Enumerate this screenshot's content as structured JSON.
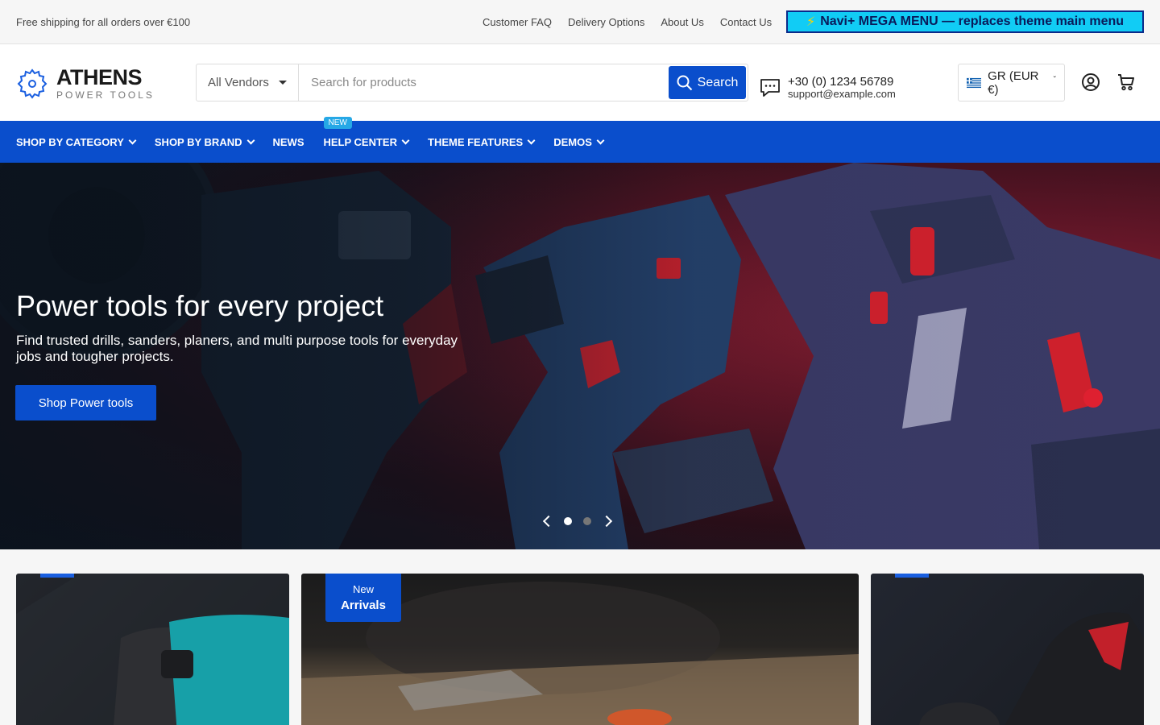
{
  "topbar": {
    "shipping": "Free shipping for all orders over €100",
    "links": [
      "Customer FAQ",
      "Delivery Options",
      "About Us",
      "Contact Us"
    ],
    "mega_menu": "Navi+ MEGA MENU — replaces theme main menu"
  },
  "header": {
    "logo_title": "ATHENS",
    "logo_subtitle": "POWER TOOLS",
    "vendor_select": "All Vendors",
    "search_placeholder": "Search for products",
    "search_button": "Search",
    "phone": "+30 (0) 1234 56789",
    "email": "support@example.com",
    "currency": "GR (EUR €)"
  },
  "nav": {
    "items": [
      "SHOP BY CATEGORY",
      "SHOP BY BRAND",
      "NEWS",
      "HELP CENTER",
      "THEME FEATURES",
      "DEMOS"
    ],
    "new_badge": "NEW"
  },
  "hero": {
    "title": "Power tools for every project",
    "subtitle": "Find trusted drills, sanders, planers, and multi purpose tools for everyday jobs and tougher projects.",
    "cta": "Shop Power tools",
    "slides": 2,
    "active_slide": 1
  },
  "cards": {
    "new_tag_line1": "New",
    "new_tag_line2": "Arrivals"
  },
  "colors": {
    "primary": "#0a4ecc",
    "mega": "#11ccf5",
    "badge": "#26a8e6"
  }
}
